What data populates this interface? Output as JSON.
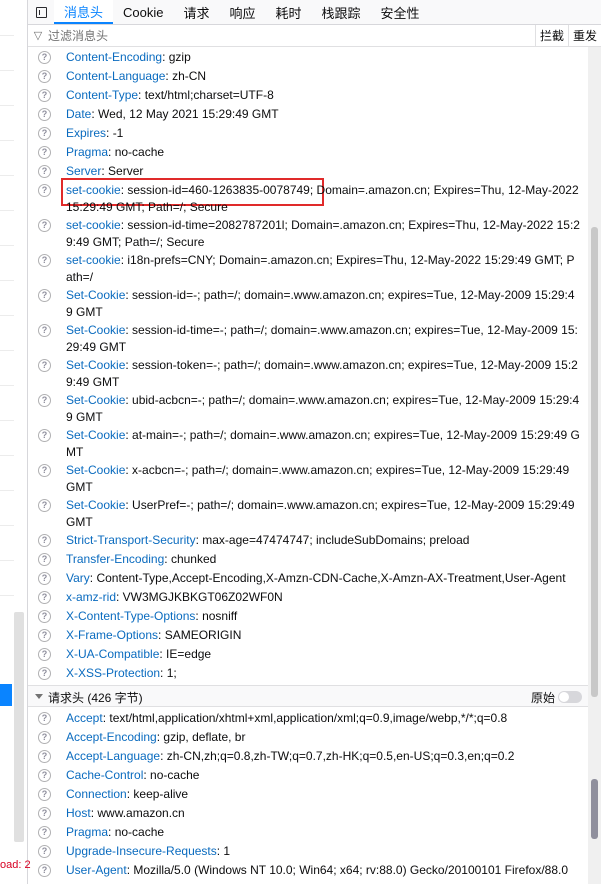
{
  "tabs": [
    "消息头",
    "Cookie",
    "请求",
    "响应",
    "耗时",
    "栈跟踪",
    "安全性"
  ],
  "filter": {
    "placeholder": "过滤消息头",
    "block": "拦截",
    "resend": "重发"
  },
  "left_error_text": "oad: 2",
  "response_headers": [
    {
      "k": "Content-Encoding",
      "v": "gzip"
    },
    {
      "k": "Content-Language",
      "v": "zh-CN"
    },
    {
      "k": "Content-Type",
      "v": "text/html;charset=UTF-8"
    },
    {
      "k": "Date",
      "v": "Wed, 12 May 2021 15:29:49 GMT"
    },
    {
      "k": "Expires",
      "v": "-1"
    },
    {
      "k": "Pragma",
      "v": "no-cache"
    },
    {
      "k": "Server",
      "v": "Server"
    },
    {
      "k": "set-cookie",
      "v": "session-id=460-1263835-0078749; Domain=.amazon.cn; Expires=Thu, 12-May-2022 15:29:49 GMT; Path=/; Secure"
    },
    {
      "k": "set-cookie",
      "v": "session-id-time=2082787201l; Domain=.amazon.cn; Expires=Thu, 12-May-2022 15:29:49 GMT; Path=/; Secure"
    },
    {
      "k": "set-cookie",
      "v": "i18n-prefs=CNY; Domain=.amazon.cn; Expires=Thu, 12-May-2022 15:29:49 GMT; Path=/"
    },
    {
      "k": "Set-Cookie",
      "v": "session-id=-; path=/; domain=.www.amazon.cn; expires=Tue, 12-May-2009 15:29:49 GMT"
    },
    {
      "k": "Set-Cookie",
      "v": "session-id-time=-; path=/; domain=.www.amazon.cn; expires=Tue, 12-May-2009 15:29:49 GMT"
    },
    {
      "k": "Set-Cookie",
      "v": "session-token=-; path=/; domain=.www.amazon.cn; expires=Tue, 12-May-2009 15:29:49 GMT"
    },
    {
      "k": "Set-Cookie",
      "v": "ubid-acbcn=-; path=/; domain=.www.amazon.cn; expires=Tue, 12-May-2009 15:29:49 GMT"
    },
    {
      "k": "Set-Cookie",
      "v": "at-main=-; path=/; domain=.www.amazon.cn; expires=Tue, 12-May-2009 15:29:49 GMT"
    },
    {
      "k": "Set-Cookie",
      "v": "x-acbcn=-; path=/; domain=.www.amazon.cn; expires=Tue, 12-May-2009 15:29:49 GMT"
    },
    {
      "k": "Set-Cookie",
      "v": "UserPref=-; path=/; domain=.www.amazon.cn; expires=Tue, 12-May-2009 15:29:49 GMT"
    },
    {
      "k": "Strict-Transport-Security",
      "v": "max-age=47474747; includeSubDomains; preload"
    },
    {
      "k": "Transfer-Encoding",
      "v": "chunked"
    },
    {
      "k": "Vary",
      "v": "Content-Type,Accept-Encoding,X-Amzn-CDN-Cache,X-Amzn-AX-Treatment,User-Agent"
    },
    {
      "k": "x-amz-rid",
      "v": "VW3MGJKBKGT06Z02WF0N"
    },
    {
      "k": "X-Content-Type-Options",
      "v": "nosniff"
    },
    {
      "k": "X-Frame-Options",
      "v": "SAMEORIGIN"
    },
    {
      "k": "X-UA-Compatible",
      "v": "IE=edge"
    },
    {
      "k": "X-XSS-Protection",
      "v": "1;"
    }
  ],
  "request_section": {
    "title": "请求头 (426 字节)",
    "raw_label": "原始"
  },
  "request_headers": [
    {
      "k": "Accept",
      "v": "text/html,application/xhtml+xml,application/xml;q=0.9,image/webp,*/*;q=0.8"
    },
    {
      "k": "Accept-Encoding",
      "v": "gzip, deflate, br"
    },
    {
      "k": "Accept-Language",
      "v": "zh-CN,zh;q=0.8,zh-TW;q=0.7,zh-HK;q=0.5,en-US;q=0.3,en;q=0.2"
    },
    {
      "k": "Cache-Control",
      "v": "no-cache"
    },
    {
      "k": "Connection",
      "v": "keep-alive"
    },
    {
      "k": "Host",
      "v": "www.amazon.cn"
    },
    {
      "k": "Pragma",
      "v": "no-cache"
    },
    {
      "k": "Upgrade-Insecure-Requests",
      "v": "1"
    },
    {
      "k": "User-Agent",
      "v": "Mozilla/5.0 (Windows NT 10.0; Win64; x64; rv:88.0) Gecko/20100101 Firefox/88.0"
    }
  ],
  "colors": {
    "accent": "#0a84ff",
    "header_name": "#0a6bbf",
    "highlight_box": "#e02a2a"
  }
}
